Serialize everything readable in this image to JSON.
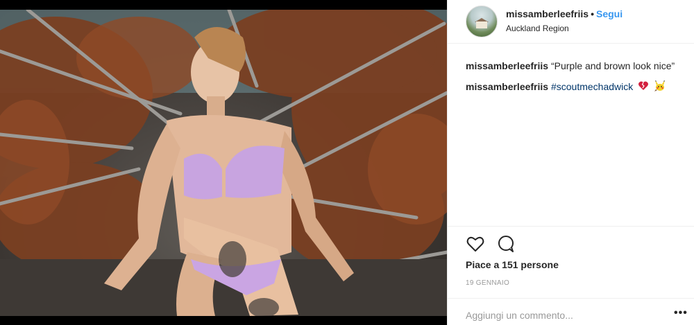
{
  "post": {
    "username": "missamberleefriis",
    "separator": "•",
    "follow_label": "Segui",
    "location": "Auckland Region",
    "comments": [
      {
        "user": "missamberleefriis",
        "text": "“Purple and brown look nice”"
      },
      {
        "user": "missamberleefriis",
        "hashtag": "#scoutmechadwick",
        "emojis": [
          "broken-heart-icon",
          "pikachu-icon"
        ]
      }
    ],
    "likes_text": "Piace a 151 persone",
    "date": "19 GENNAIO",
    "add_comment_placeholder": "Aggiungi un commento...",
    "more_label": "•••"
  },
  "colors": {
    "accent": "#3897f0",
    "hashtag": "#003569",
    "muted": "#999999",
    "text": "#262626"
  },
  "icons": [
    "heart-icon",
    "comment-icon"
  ]
}
